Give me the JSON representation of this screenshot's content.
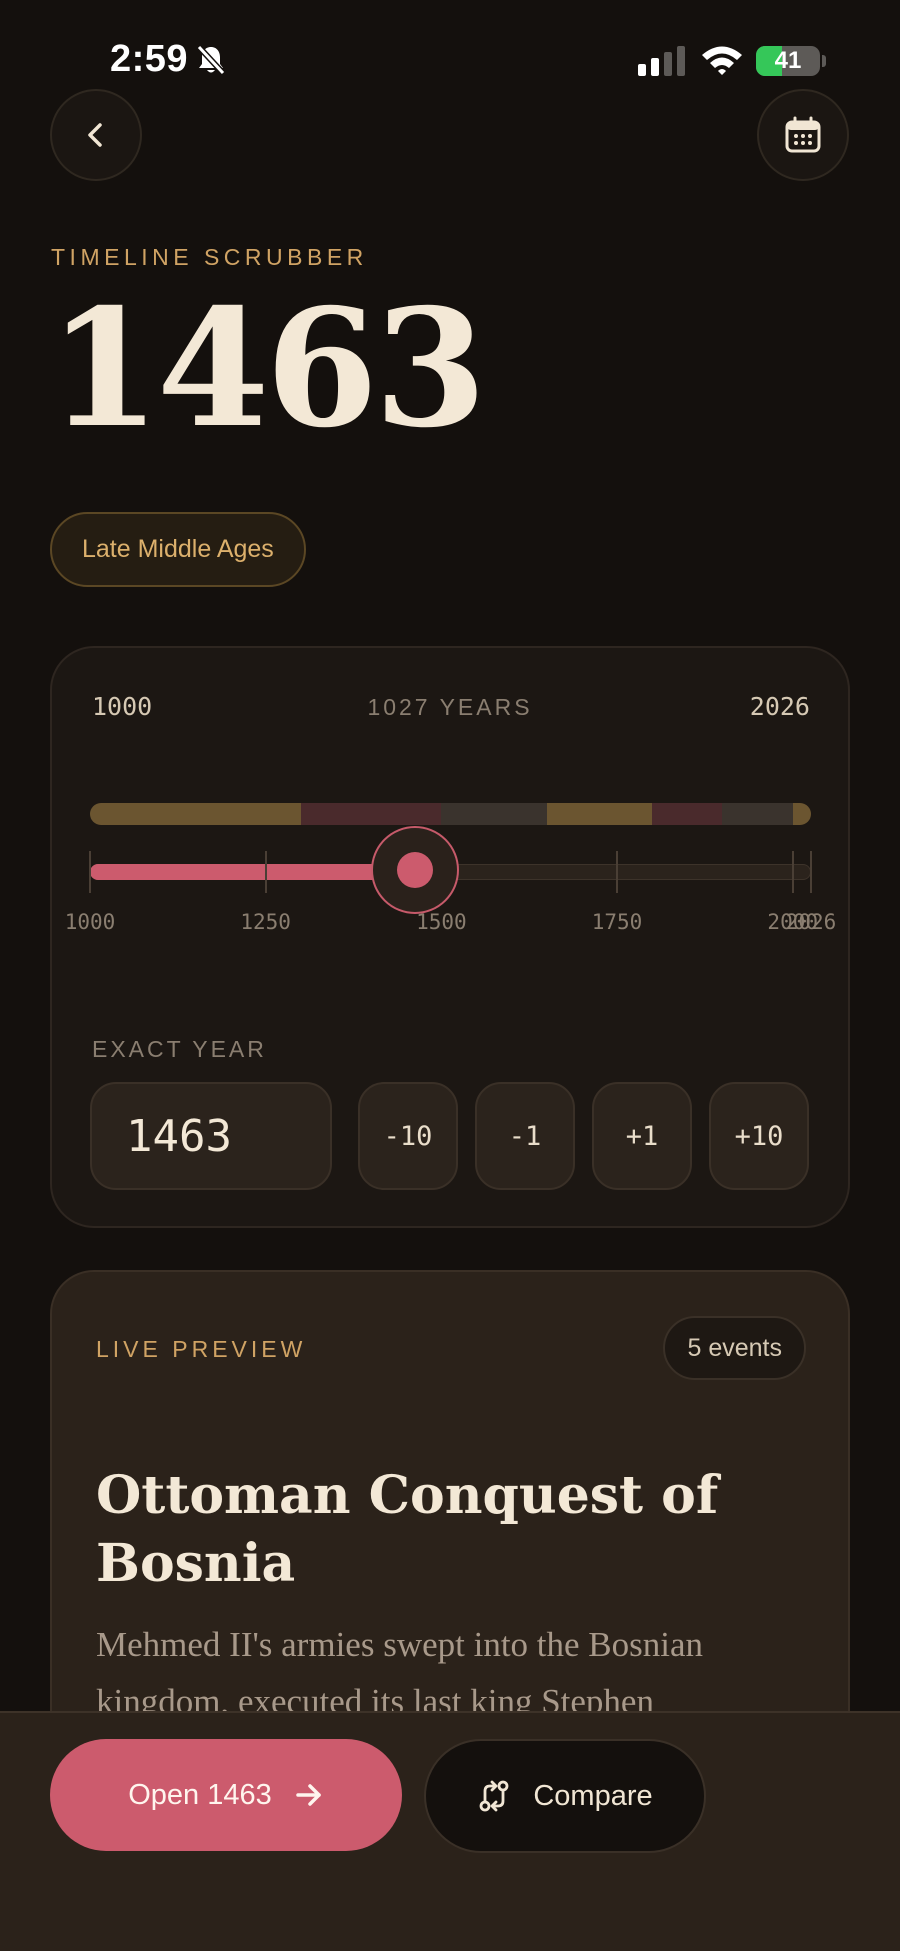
{
  "status_bar": {
    "time": "2:59",
    "battery_percent": "41"
  },
  "header": {
    "back_icon": "chevron-left-icon",
    "calendar_icon": "calendar-icon"
  },
  "hero": {
    "eyebrow": "TIMELINE SCRUBBER",
    "year": "1463",
    "era": "Late Middle Ages"
  },
  "scrubber": {
    "range_start": "1000",
    "range_span": "1027 YEARS",
    "range_end": "2026",
    "min": 1000,
    "max": 2026,
    "value": 1463,
    "ticks": [
      "1000",
      "1250",
      "1500",
      "1750",
      "2000",
      "2026"
    ],
    "era_bands": [
      {
        "from": 1000,
        "to": 1300,
        "color": "#6b5530"
      },
      {
        "from": 1300,
        "to": 1500,
        "color": "#4a2a2c"
      },
      {
        "from": 1500,
        "to": 1650,
        "color": "#3a332d"
      },
      {
        "from": 1650,
        "to": 1800,
        "color": "#6b5530"
      },
      {
        "from": 1800,
        "to": 1900,
        "color": "#4a2a2c"
      },
      {
        "from": 1900,
        "to": 2000,
        "color": "#3a332d"
      },
      {
        "from": 2000,
        "to": 2026,
        "color": "#6b5530"
      }
    ],
    "exact_label": "EXACT YEAR",
    "input_value": "1463",
    "steps": [
      "-10",
      "-1",
      "+1",
      "+10"
    ]
  },
  "preview": {
    "label": "LIVE PREVIEW",
    "events_badge": "5 events",
    "title": "Ottoman Conquest of Bosnia",
    "body": "Mehmed II's armies swept into the Bosnian kingdom, executed its last king Stephen"
  },
  "actions": {
    "open_label": "Open 1463",
    "compare_label": "Compare"
  },
  "colors": {
    "accent": "#cc5b6d",
    "gold": "#d0a364",
    "background": "#14100d"
  }
}
